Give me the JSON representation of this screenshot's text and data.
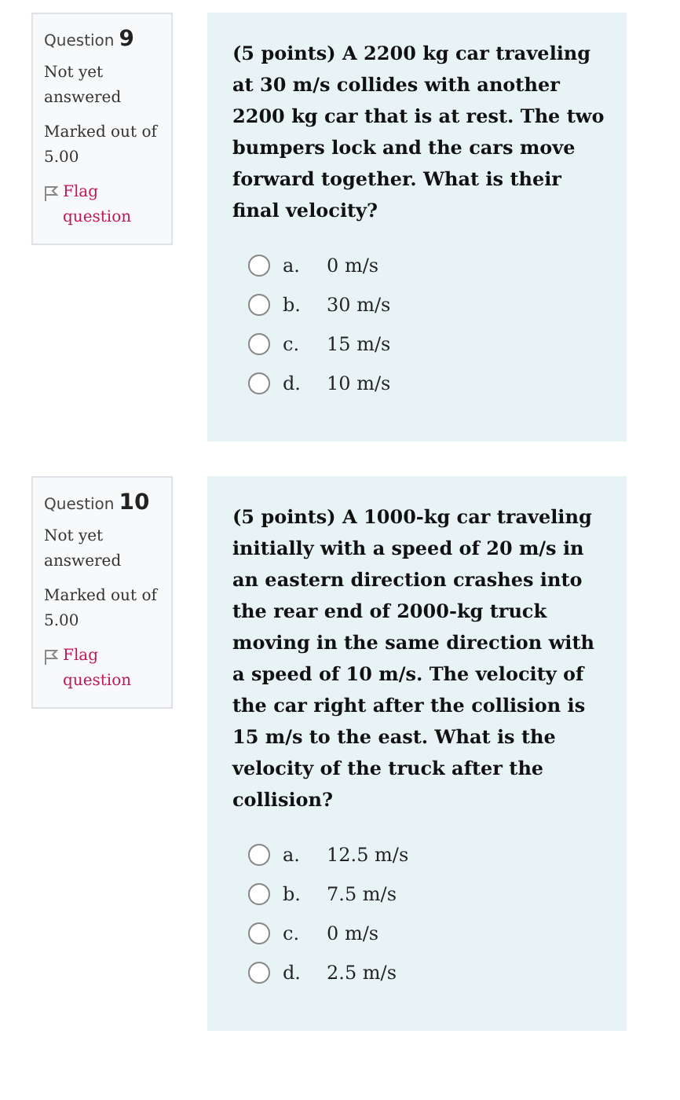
{
  "questions": [
    {
      "label": "Question",
      "number": "9",
      "status": "Not yet answered",
      "marks": "Marked out of 5.00",
      "flag": "Flag question",
      "text": "(5 points) A 2200 kg car traveling at 30 m/s collides with another 2200 kg car that is at rest. The two bumpers lock and the cars move forward together. What is their final velocity?",
      "answers": [
        {
          "letter": "a.",
          "text": "0 m/s",
          "selected": false
        },
        {
          "letter": "b.",
          "text": "30 m/s",
          "selected": false
        },
        {
          "letter": "c.",
          "text": "15 m/s",
          "selected": false
        },
        {
          "letter": "d.",
          "text": "10 m/s",
          "selected": false
        }
      ]
    },
    {
      "label": "Question",
      "number": "10",
      "status": "Not yet answered",
      "marks": "Marked out of 5.00",
      "flag": "Flag question",
      "text": "(5 points) A 1000-kg car traveling initially with a speed of 20 m/s in an eastern direction crashes into the rear end of 2000-kg truck moving in the same direction with a speed of 10 m/s. The velocity of the car right after the collision is 15 m/s to the east. What is the velocity of the truck after the collision?",
      "answers": [
        {
          "letter": "a.",
          "text": "12.5 m/s",
          "selected": false
        },
        {
          "letter": "b.",
          "text": "7.5 m/s",
          "selected": false
        },
        {
          "letter": "c.",
          "text": "0 m/s",
          "selected": false
        },
        {
          "letter": "d.",
          "text": "2.5 m/s",
          "selected": false
        }
      ]
    }
  ]
}
